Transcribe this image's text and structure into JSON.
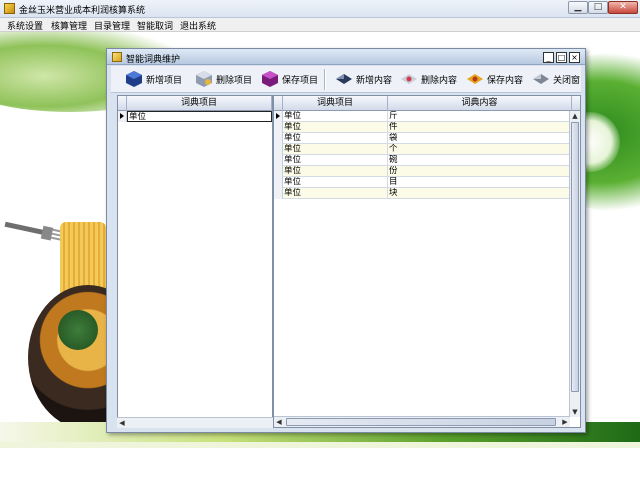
{
  "app": {
    "title": "金丝玉米营业成本利润核算系统",
    "window_buttons": {
      "minimize": "▁",
      "maximize": "□",
      "close": "✕"
    }
  },
  "menu": [
    "系统设置",
    "核算管理",
    "目录管理",
    "智能取词",
    "退出系统"
  ],
  "dialog": {
    "title": "智能词典维护",
    "buttons": {
      "minimize": "_",
      "maximize": "□",
      "close": "×"
    },
    "toolbar": {
      "new_item": "新增项目",
      "delete_item": "删除项目",
      "save_item": "保存项目",
      "new_content": "新增内容",
      "delete_content": "删除内容",
      "save_content": "保存内容",
      "close_window": "关闭窗"
    },
    "left_grid": {
      "header": "词典项目",
      "rows": [
        "单位"
      ]
    },
    "right_grid": {
      "headers": [
        "词典项目",
        "词典内容"
      ],
      "rows": [
        [
          "单位",
          "斤"
        ],
        [
          "单位",
          "件"
        ],
        [
          "单位",
          "袋"
        ],
        [
          "单位",
          "个"
        ],
        [
          "单位",
          "碗"
        ],
        [
          "单位",
          "份"
        ],
        [
          "单位",
          "目"
        ],
        [
          "单位",
          "块"
        ]
      ]
    }
  },
  "colors": {
    "accent_green": "#1e6a17",
    "header_blue": "#d3dbe9",
    "row_alt": "#fbfbe8"
  }
}
